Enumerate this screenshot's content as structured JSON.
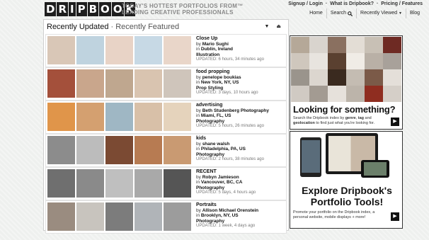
{
  "header": {
    "logo_letters": [
      "D",
      "R",
      "I",
      "P",
      "B",
      "O",
      "O",
      "K"
    ],
    "tagline_line1": "TODAY'S HOTTEST PORTFOLIOS FROM",
    "tagline_line2": "LEADING CREATIVE PROFESSIONALS",
    "tagline_tm": "™",
    "top_links": [
      "Signup / Login",
      "What is Dripbook?",
      "Pricing / Features"
    ],
    "top_sep": "·",
    "nav": {
      "home": "Home",
      "search": "Search",
      "recently_viewed": "Recently Viewed",
      "blog": "Blog"
    }
  },
  "panel": {
    "title": "Recently Updated",
    "subtitle": " · Recently Featured",
    "sort_down": "▼",
    "sort_up": "⏏"
  },
  "rows": [
    {
      "title": "Close Up",
      "by": "by",
      "author": "Mario Sughi",
      "in": "in",
      "location": "Dublin, Ireland",
      "category": "Illustration",
      "updated": "UPDATED: 6 hours, 34 minutes ago",
      "thumb_colors": [
        "#d9c7b7",
        "#bfd3df",
        "#e8d3c6",
        "#c7d9e5",
        "#e9d6c9"
      ]
    },
    {
      "title": "food propping",
      "by": "by",
      "author": "penelope boukias",
      "in": "in",
      "location": "New York, NY, US",
      "category": "Prop Styling",
      "updated": "UPDATED: 3 days, 10 hours ago",
      "thumb_colors": [
        "#a4503b",
        "#c9a68c",
        "#bfa78f",
        "#d9c4b0",
        "#cfc5bb"
      ]
    },
    {
      "title": "advertising",
      "by": "by",
      "author": "Beth Studenberg Photography",
      "in": "in",
      "location": "Miami, FL, US",
      "category": "Photography",
      "updated": "UPDATED: 5 hours, 26 minutes ago",
      "thumb_colors": [
        "#e0954a",
        "#d4a070",
        "#9fb7c4",
        "#d8c0a8",
        "#e5d3bc"
      ]
    },
    {
      "title": "kids",
      "by": "by",
      "author": "shane walsh",
      "in": "in",
      "location": "Philadelphia, PA, US",
      "category": "Photography",
      "updated": "UPDATED: 2 hours, 38 minutes ago",
      "thumb_colors": [
        "#8c8c8c",
        "#bcbcbc",
        "#7b4a33",
        "#b77b52",
        "#c99a72"
      ]
    },
    {
      "title": "RECENT",
      "by": "by",
      "author": "Robyn Jamieson",
      "in": "in",
      "location": "Vancouver, BC, CA",
      "category": "Photography",
      "updated": "UPDATED: 5 days, 4 hours ago",
      "thumb_colors": [
        "#6f6f6f",
        "#8a8a8a",
        "#bfbfbf",
        "#a9a9a9",
        "#555555"
      ]
    },
    {
      "title": "Portraits",
      "by": "by",
      "author": "Allison Michael Orenstein",
      "in": "in",
      "location": "Brooklyn, NY, US",
      "category": "Photography",
      "updated": "UPDATED: 1 week, 4 days ago",
      "thumb_colors": [
        "#9a8c80",
        "#c8c4be",
        "#7c7c7c",
        "#b0b4b8",
        "#9c9c9c"
      ]
    }
  ],
  "ad_search": {
    "headline": "Looking for something?",
    "body_pre": "Search the Dripbook index by ",
    "body_kw1": "genre",
    "body_mid1": ", ",
    "body_kw2": "tag",
    "body_mid2": " and ",
    "body_kw3": "geolocation",
    "body_post": " to find just what you're looking for.",
    "arrow": "▶",
    "mosaic_colors": [
      "#b5a898",
      "#d9d4ce",
      "#8a7060",
      "#e3ddd5",
      "#c8c0b5",
      "#6e2a23",
      "#cfc7bd",
      "#e8e4df",
      "#5a4030",
      "#f0ece6",
      "#b9b0a6",
      "#a8a19a",
      "#9a948c",
      "#dcd6cf",
      "#3a2a1f",
      "#c4bcb2",
      "#7b5a48",
      "#e4dfd9",
      "#d0cac3",
      "#a39b92",
      "#e6e1db",
      "#bcb4aa",
      "#8f2d20",
      "#d5cfc8"
    ]
  },
  "ad_tools": {
    "headline_line1": "Explore Dripbook's",
    "headline_line2": "Portfolio Tools!",
    "body": "Promote your portfolio on the Dripbook index, a personal website, mobile displays + more!",
    "arrow": "▶"
  }
}
